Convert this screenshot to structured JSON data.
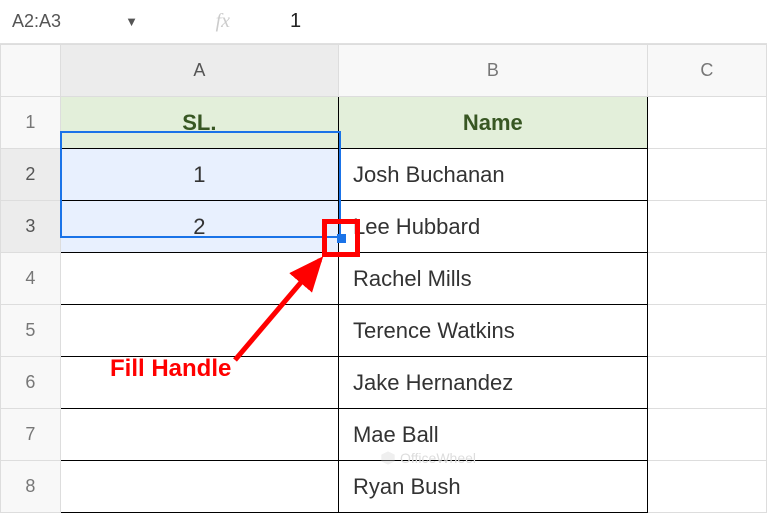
{
  "formula_bar": {
    "name_box": "A2:A3",
    "fx_label": "fx",
    "fx_value": "1"
  },
  "columns": [
    "A",
    "B",
    "C"
  ],
  "rows": [
    "1",
    "2",
    "3",
    "4",
    "5",
    "6",
    "7",
    "8"
  ],
  "headers": {
    "colA": "SL.",
    "colB": "Name"
  },
  "data": {
    "a": [
      "1",
      "2",
      "",
      "",
      "",
      "",
      ""
    ],
    "b": [
      "Josh Buchanan",
      "Lee Hubbard",
      "Rachel Mills",
      "Terence Watkins",
      "Jake Hernandez",
      "Mae Ball",
      "Ryan Bush"
    ]
  },
  "annotation": {
    "label": "Fill Handle"
  },
  "watermark": "OfficeWheel"
}
